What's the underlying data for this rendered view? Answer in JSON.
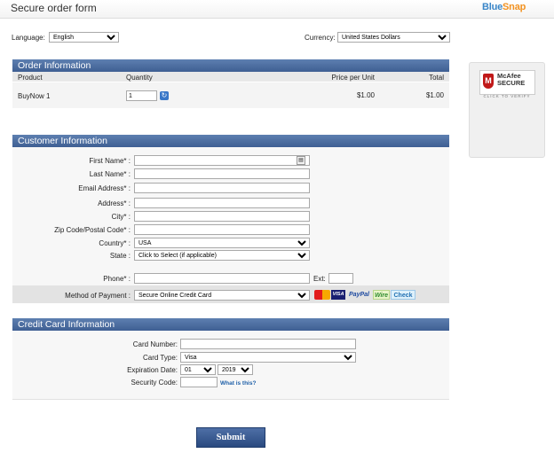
{
  "header": {
    "title": "Secure order form",
    "brand_a": "Blue",
    "brand_b": "Snap"
  },
  "top": {
    "language_label": "Language:",
    "language_value": "English",
    "currency_label": "Currency:",
    "currency_value": "United States Dollars"
  },
  "order": {
    "section_title": "Order Information",
    "columns": {
      "product": "Product",
      "quantity": "Quantity",
      "price": "Price per Unit",
      "total": "Total"
    },
    "row": {
      "product": "BuyNow 1",
      "quantity": "1",
      "price": "$1.00",
      "total": "$1.00"
    }
  },
  "mcafee": {
    "shield": "M",
    "line1": "McAfee",
    "line2": "SECURE",
    "verify": "CLICK TO VERIFY",
    "shield_color": "#c01818"
  },
  "customer": {
    "section_title": "Customer Information",
    "first_name_label": "First Name*",
    "last_name_label": "Last Name*",
    "email_label": "Email Address*",
    "address_label": "Address*",
    "city_label": "City*",
    "zip_label": "Zip Code/Postal Code*",
    "country_label": "Country*",
    "country_value": "USA",
    "state_label": "State",
    "state_value": "Click to Select (if applicable)",
    "phone_label": "Phone*",
    "ext_label": "Ext:",
    "payment_label": "Method of Payment",
    "payment_value": "Secure Online Credit Card",
    "payment_logos": [
      "VISA",
      "PayPal",
      "Wire",
      "Check"
    ]
  },
  "card": {
    "section_title": "Credit Card Information",
    "number_label": "Card Number:",
    "type_label": "Card Type:",
    "type_value": "Visa",
    "expiration_label": "Expiration Date:",
    "exp_month": "01",
    "exp_year": "2019",
    "security_label": "Security Code:",
    "what_link": "What is this?"
  },
  "submit_label": "Submit",
  "colors": {
    "section_bar": "#4a6b9f",
    "link": "#1d5fa8",
    "brand": "#3a86c8",
    "brand_accent": "#f29221"
  }
}
